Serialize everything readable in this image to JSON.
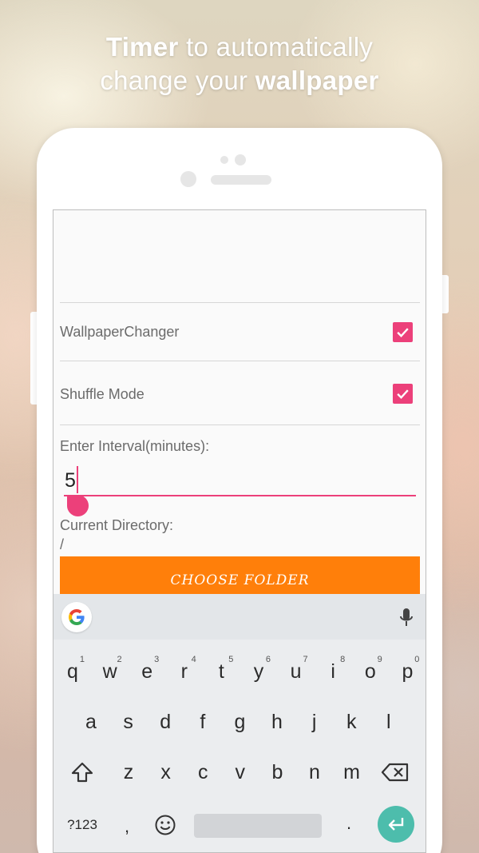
{
  "headline": {
    "bold1": "Timer",
    "text1": " to automatically",
    "text2": "change your ",
    "bold2": "wallpaper"
  },
  "settings": {
    "wallpaper_changer_label": "WallpaperChanger",
    "wallpaper_changer_checked": true,
    "shuffle_label": "Shuffle Mode",
    "shuffle_checked": true,
    "interval_label": "Enter Interval(minutes):",
    "interval_value": "5",
    "directory_label": "Current Directory:",
    "directory_value": "/",
    "choose_folder_label": "CHOOSE FOLDER"
  },
  "keyboard": {
    "row1": [
      {
        "key": "q",
        "hint": "1"
      },
      {
        "key": "w",
        "hint": "2"
      },
      {
        "key": "e",
        "hint": "3"
      },
      {
        "key": "r",
        "hint": "4"
      },
      {
        "key": "t",
        "hint": "5"
      },
      {
        "key": "y",
        "hint": "6"
      },
      {
        "key": "u",
        "hint": "7"
      },
      {
        "key": "i",
        "hint": "8"
      },
      {
        "key": "o",
        "hint": "9"
      },
      {
        "key": "p",
        "hint": "0"
      }
    ],
    "row2": [
      "a",
      "s",
      "d",
      "f",
      "g",
      "h",
      "j",
      "k",
      "l"
    ],
    "row3": [
      "z",
      "x",
      "c",
      "v",
      "b",
      "n",
      "m"
    ],
    "symbols_label": "?123",
    "comma": ",",
    "period": "."
  },
  "colors": {
    "accent": "#ec407a",
    "button": "#ff7f0a",
    "enter": "#4dbdac"
  },
  "icons": [
    "google-g-icon",
    "mic-icon",
    "shift-icon",
    "backspace-icon",
    "emoji-icon",
    "enter-icon",
    "checkbox-checked-icon"
  ]
}
